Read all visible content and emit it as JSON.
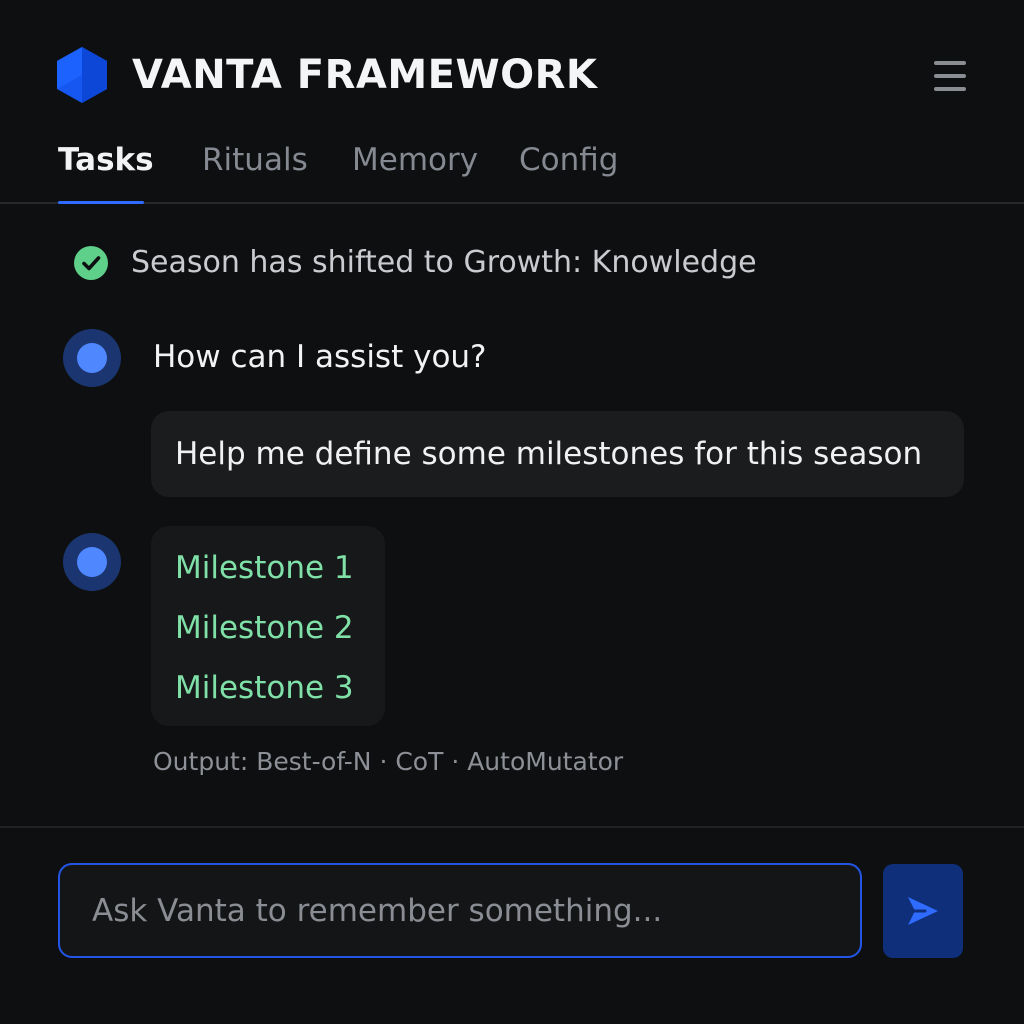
{
  "app": {
    "title": "VANTA FRAMEWORK",
    "logo_icon": "hexagon-logo-icon",
    "menu_icon": "hamburger-menu-icon"
  },
  "tabs": [
    {
      "label": "Tasks",
      "active": true
    },
    {
      "label": "Rituals",
      "active": false
    },
    {
      "label": "Memory",
      "active": false
    },
    {
      "label": "Config",
      "active": false
    }
  ],
  "status": {
    "icon": "check-circle-icon",
    "text": "Season has shifted to Growth: Knowledge"
  },
  "conversation": {
    "assistant_prompt": "How can I assist you?",
    "user_message": "Help me define some milestones for this season",
    "milestones": [
      "Milestone 1",
      "Milestone 2",
      "Milestone 3"
    ],
    "output_meta": "Output: Best-of-N · CoT · AutoMutator"
  },
  "composer": {
    "placeholder": "Ask Vanta to remember something...",
    "value": "",
    "send_icon": "send-arrow-icon"
  },
  "colors": {
    "background": "#0e0f10",
    "accent": "#2f6bff",
    "milestone_green": "#7fe0a8",
    "status_green": "#5fd08a",
    "avatar_dot": "#4f87ff"
  }
}
